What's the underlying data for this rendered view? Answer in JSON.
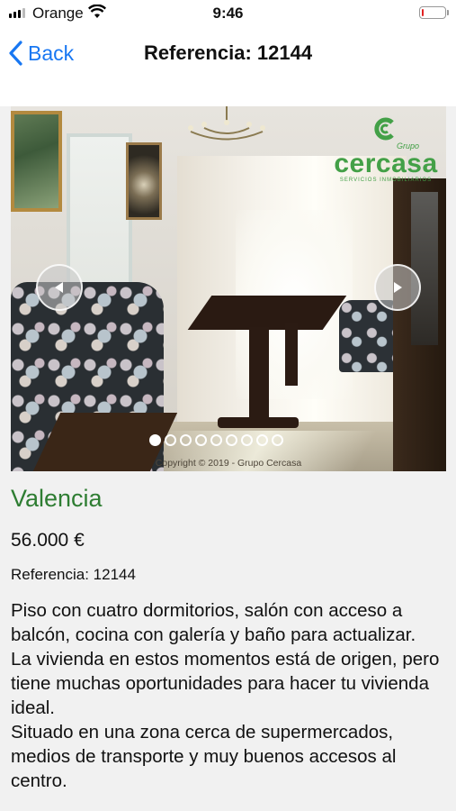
{
  "status_bar": {
    "carrier": "Orange",
    "time": "9:46",
    "signal_bars": 3,
    "battery_level": 0.08,
    "battery_color": "#e22222",
    "icons": [
      "signal-icon",
      "wifi-icon",
      "battery-icon"
    ]
  },
  "nav": {
    "back_label": "Back",
    "title": "Referencia: 12144",
    "accent_color": "#1877f2"
  },
  "gallery": {
    "logo_text": "cercasa",
    "logo_top": "Grupo",
    "logo_subtitle": "SERVICIOS INMOBILIARIOS",
    "copyright": "Copyright © 2019 - Grupo Cercasa",
    "dot_count": 9,
    "active_index": 0,
    "icons": [
      "prev-arrow-icon",
      "next-arrow-icon"
    ]
  },
  "property": {
    "city": "Valencia",
    "city_color": "#2e7d32",
    "price": "56.000 €",
    "reference": "Referencia: 12144",
    "description": [
      "Piso con cuatro dormitorios, salón con acceso a balcón, cocina con galería y baño para actualizar.",
      "La vivienda en estos momentos está de origen, pero tiene muchas oportunidades para hacer tu vivienda ideal.",
      "Situado en una zona cerca de supermercados, medios de transporte y muy buenos accesos al centro."
    ]
  }
}
